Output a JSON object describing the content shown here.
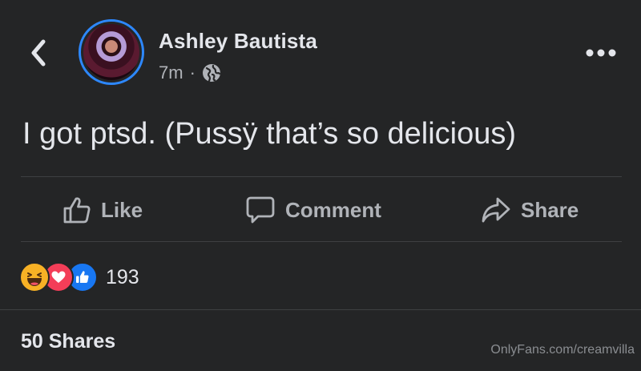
{
  "post": {
    "author": "Ashley Bautista",
    "time": "7m",
    "separator": "·",
    "text": "I got ptsd. (Pussÿ that’s so delicious)"
  },
  "actions": {
    "like": "Like",
    "comment": "Comment",
    "share": "Share"
  },
  "reactions": {
    "count": "193",
    "types": [
      "haha",
      "love",
      "like"
    ]
  },
  "shares_label": "50 Shares",
  "watermark": "OnlyFans.com/creamvilla",
  "icons": [
    "back-icon",
    "globe-icon",
    "more-icon",
    "like-icon",
    "comment-icon",
    "share-icon"
  ],
  "colors": {
    "background": "#242526",
    "accent": "#2d88ff",
    "text": "#e4e6eb",
    "secondary_text": "#b0b3b8",
    "love": "#f33e58",
    "haha": "#f7b125"
  }
}
